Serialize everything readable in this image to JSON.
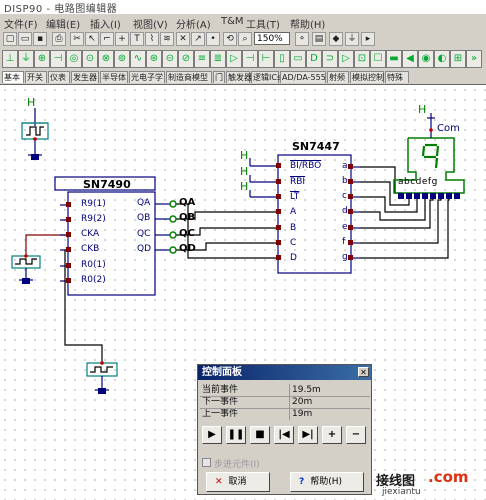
{
  "window": {
    "title": "DISP90 - 电路图编辑器"
  },
  "menu": {
    "items": [
      {
        "label": "文件(F)"
      },
      {
        "label": "编辑(E)"
      },
      {
        "label": "插入(I)"
      },
      {
        "label": "视图(V)"
      },
      {
        "label": "分析(A)"
      },
      {
        "label": "T&M"
      },
      {
        "label": "工具(T)"
      },
      {
        "label": "帮助(H)"
      }
    ]
  },
  "toolbar": {
    "zoom_value": "150%"
  },
  "tabs": [
    "基本",
    "开关",
    "仪表",
    "发生器",
    "半导体",
    "光电子学",
    "制造商模型",
    "门",
    "触发器",
    "逻辑ICs",
    "AD/DA-555",
    "射频",
    "模拟控制",
    "特殊"
  ],
  "schematic": {
    "chip_7490": {
      "name": "SN7490",
      "left_pins": [
        "R9(1)",
        "R9(2)",
        "CKA",
        "CKB",
        "R0(1)",
        "R0(2)"
      ],
      "right_pins": [
        "QA",
        "QB",
        "QC",
        "QD"
      ]
    },
    "outputs": [
      "QA",
      "QB",
      "QC",
      "QD"
    ],
    "chip_7447": {
      "name": "SN7447",
      "left_pins": [
        "BI/RBO",
        "RBI",
        "LT",
        "A",
        "B",
        "C",
        "D"
      ],
      "right_pins": [
        "a",
        "b",
        "c",
        "d",
        "e",
        "f",
        "g"
      ]
    },
    "display": {
      "digit": "9",
      "segments": "abcdefg",
      "com_label": "Com"
    },
    "high_label": "H"
  },
  "control_panel": {
    "title": "控制面板",
    "rows": [
      {
        "label": "当前事件",
        "value": "19.5m"
      },
      {
        "label": "下一事件",
        "value": "20m"
      },
      {
        "label": "上一事件",
        "value": "19m"
      }
    ],
    "step_checkbox_label": "步进元件(I)",
    "cancel_label": "取消",
    "help_label": "帮助(H)"
  },
  "watermark": {
    "cn": "接线图",
    "dot": ".com",
    "en": "jiexiantu"
  }
}
